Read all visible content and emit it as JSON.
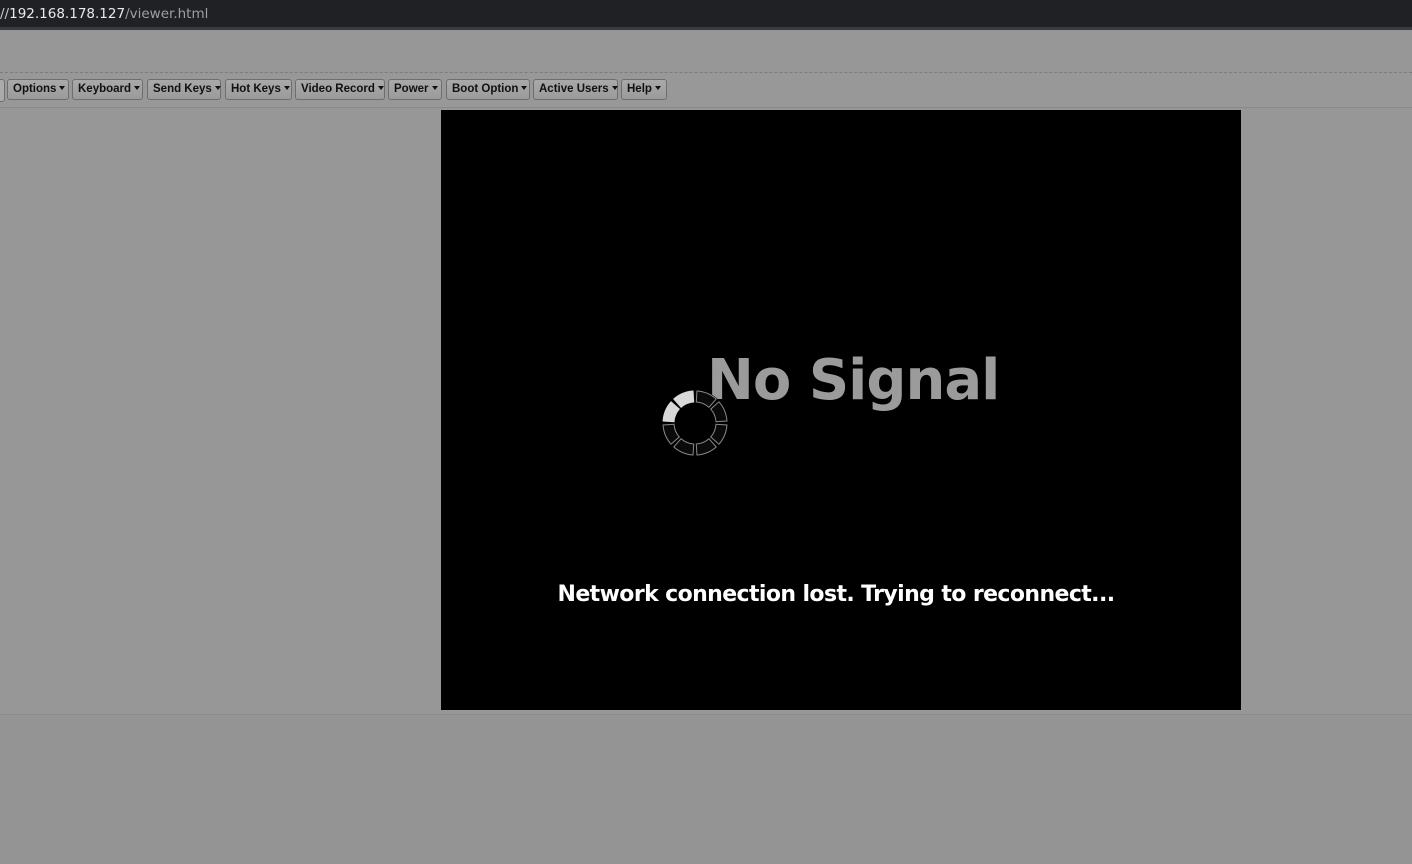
{
  "browser": {
    "url_prefix": "//",
    "url_host": "192.168.178.127",
    "url_path": "/viewer.html"
  },
  "toolbar": {
    "menus": [
      {
        "label": "Options"
      },
      {
        "label": "Keyboard"
      },
      {
        "label": "Send Keys"
      },
      {
        "label": "Hot Keys"
      },
      {
        "label": "Video Record"
      },
      {
        "label": "Power"
      },
      {
        "label": "Boot Option"
      },
      {
        "label": "Active Users"
      },
      {
        "label": "Help"
      }
    ]
  },
  "screen": {
    "title": "No Signal",
    "message": "Network connection lost. Trying to reconnect...",
    "spinner_icon": "loading-spinner-icon"
  },
  "colors": {
    "page_background": "#969696",
    "screen_background": "#000000",
    "title_color": "#9b9b9b",
    "message_color": "#ffffff",
    "url_bar_background": "#202124"
  }
}
